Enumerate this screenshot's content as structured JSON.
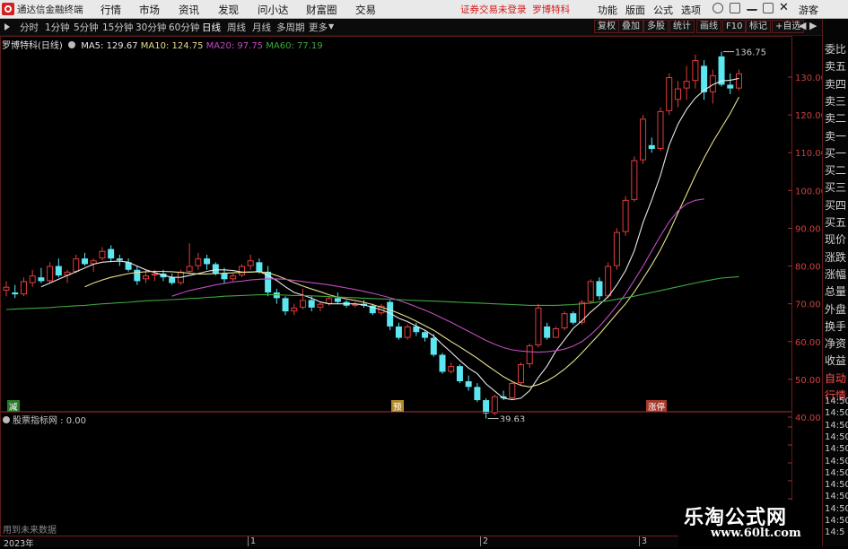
{
  "app": {
    "title": "通达信金融终端"
  },
  "menu": [
    "行情",
    "市场",
    "资讯",
    "发现",
    "问小达",
    "财富圈",
    "交易"
  ],
  "notice": "证券交易未登录",
  "stock_tag": "罗博特科",
  "toolbar_right": [
    "功能",
    "版面",
    "公式",
    "选项"
  ],
  "guest": "游客",
  "periods": [
    "分时",
    "1分钟",
    "5分钟",
    "15分钟",
    "30分钟",
    "60分钟",
    "日线",
    "周线",
    "月线",
    "多周期",
    "更多"
  ],
  "active_period": "日线",
  "right_buttons": [
    "复权",
    "叠加",
    "多股",
    "统计",
    "画线",
    "F10",
    "标记",
    "+自选"
  ],
  "chart_header": {
    "stock": "罗博特科",
    "period": "(日线)",
    "ma5": "MA5: 129.67",
    "ma10": "MA10: 124.75",
    "ma20": "MA20: 97.75",
    "ma60": "MA60: 77.19"
  },
  "price_axis": [
    "130.00",
    "120.00",
    "110.00",
    "100.00",
    "90.00",
    "80.00",
    "70.00",
    "60.00",
    "50.00",
    "40.00"
  ],
  "annotations": {
    "high": "136.75",
    "low": "39.63"
  },
  "event_markers": [
    "减",
    "预",
    "涨停"
  ],
  "right_panel": [
    "委比",
    "卖五",
    "卖四",
    "卖三",
    "卖二",
    "卖一",
    "买一",
    "买二",
    "买三",
    "买四",
    "买五",
    "现价",
    "涨跌",
    "涨幅",
    "总量",
    "外盘",
    "换手",
    "净资",
    "收益",
    "自动",
    "行情",
    "14:50",
    "14:50",
    "14:50",
    "14:50",
    "14:50",
    "14:50",
    "14:50",
    "14:50",
    "14:50",
    "14:50",
    "14:50",
    "14:5"
  ],
  "sub_indicator": "股票指标网 : 0.00",
  "nodata": "用到未来数据",
  "time_axis": [
    "2023年",
    "1",
    "2",
    "3"
  ],
  "watermark": {
    "title": "乐淘公式网",
    "url": "www.60lt.com"
  },
  "colors": {
    "up": "#e33b3b",
    "down": "#5ce6f0",
    "ma5": "#e8e8e8",
    "ma10": "#e8df8c",
    "ma20": "#c04bc0",
    "ma60": "#3fa73f"
  },
  "chart_data": {
    "type": "candlestick",
    "ylim": [
      37,
      142
    ],
    "candles": [
      {
        "o": 73.5,
        "h": 76,
        "l": 72,
        "c": 74.5
      },
      {
        "o": 73,
        "h": 75,
        "l": 71.5,
        "c": 72.5
      },
      {
        "o": 72.5,
        "h": 77,
        "l": 72,
        "c": 76
      },
      {
        "o": 75.5,
        "h": 79,
        "l": 74.5,
        "c": 77.5
      },
      {
        "o": 77,
        "h": 79.5,
        "l": 75.5,
        "c": 76
      },
      {
        "o": 76,
        "h": 81,
        "l": 75.5,
        "c": 80
      },
      {
        "o": 80,
        "h": 82,
        "l": 77,
        "c": 77.5
      },
      {
        "o": 77.5,
        "h": 79,
        "l": 75.5,
        "c": 78.5
      },
      {
        "o": 78.5,
        "h": 83,
        "l": 78,
        "c": 82
      },
      {
        "o": 82,
        "h": 83.5,
        "l": 80,
        "c": 80.5
      },
      {
        "o": 80.5,
        "h": 82,
        "l": 78.5,
        "c": 81.5
      },
      {
        "o": 82,
        "h": 85,
        "l": 81.5,
        "c": 84
      },
      {
        "o": 84.5,
        "h": 85.5,
        "l": 81,
        "c": 82
      },
      {
        "o": 82,
        "h": 83,
        "l": 80,
        "c": 81.5
      },
      {
        "o": 81,
        "h": 82,
        "l": 78.5,
        "c": 79
      },
      {
        "o": 79,
        "h": 80,
        "l": 75,
        "c": 76
      },
      {
        "o": 76.5,
        "h": 79,
        "l": 75.5,
        "c": 77.5
      },
      {
        "o": 77.5,
        "h": 79,
        "l": 76,
        "c": 78
      },
      {
        "o": 78,
        "h": 79,
        "l": 76,
        "c": 77
      },
      {
        "o": 77,
        "h": 78,
        "l": 75,
        "c": 75.5
      },
      {
        "o": 75.5,
        "h": 79,
        "l": 75,
        "c": 78.5
      },
      {
        "o": 78.5,
        "h": 86,
        "l": 78,
        "c": 80
      },
      {
        "o": 80,
        "h": 83.5,
        "l": 79,
        "c": 82
      },
      {
        "o": 82,
        "h": 83,
        "l": 79,
        "c": 80.5
      },
      {
        "o": 80.5,
        "h": 81,
        "l": 77.5,
        "c": 78
      },
      {
        "o": 78,
        "h": 79.5,
        "l": 75.5,
        "c": 76.5
      },
      {
        "o": 76.5,
        "h": 78,
        "l": 76,
        "c": 77.5
      },
      {
        "o": 77.5,
        "h": 80.5,
        "l": 77,
        "c": 80
      },
      {
        "o": 80,
        "h": 83,
        "l": 79,
        "c": 81.5
      },
      {
        "o": 81,
        "h": 82,
        "l": 78,
        "c": 78.5
      },
      {
        "o": 78.5,
        "h": 80,
        "l": 72,
        "c": 73
      },
      {
        "o": 73,
        "h": 74,
        "l": 70,
        "c": 71.5
      },
      {
        "o": 71.5,
        "h": 72,
        "l": 67,
        "c": 68
      },
      {
        "o": 68,
        "h": 70,
        "l": 67,
        "c": 69
      },
      {
        "o": 69,
        "h": 74,
        "l": 68.5,
        "c": 71
      },
      {
        "o": 71,
        "h": 72,
        "l": 68,
        "c": 69
      },
      {
        "o": 69,
        "h": 70.5,
        "l": 68,
        "c": 70
      },
      {
        "o": 70,
        "h": 72,
        "l": 69.5,
        "c": 71.5
      },
      {
        "o": 71.5,
        "h": 73,
        "l": 70,
        "c": 70.5
      },
      {
        "o": 70.5,
        "h": 71,
        "l": 69,
        "c": 69.5
      },
      {
        "o": 69.5,
        "h": 70.5,
        "l": 69,
        "c": 70
      },
      {
        "o": 70,
        "h": 71,
        "l": 69,
        "c": 69.5
      },
      {
        "o": 69.5,
        "h": 70,
        "l": 67,
        "c": 67.5
      },
      {
        "o": 67.5,
        "h": 70,
        "l": 67,
        "c": 69.5
      },
      {
        "o": 70.5,
        "h": 71,
        "l": 63,
        "c": 64
      },
      {
        "o": 64,
        "h": 65,
        "l": 60.5,
        "c": 61
      },
      {
        "o": 61,
        "h": 64.5,
        "l": 60.5,
        "c": 64
      },
      {
        "o": 64,
        "h": 65,
        "l": 61.5,
        "c": 62.5
      },
      {
        "o": 62.5,
        "h": 63,
        "l": 60,
        "c": 61
      },
      {
        "o": 61,
        "h": 62,
        "l": 56,
        "c": 56.5
      },
      {
        "o": 56.5,
        "h": 57,
        "l": 51.5,
        "c": 52
      },
      {
        "o": 52,
        "h": 54.5,
        "l": 51.5,
        "c": 53.5
      },
      {
        "o": 53.5,
        "h": 54,
        "l": 49,
        "c": 49.5
      },
      {
        "o": 49.5,
        "h": 51,
        "l": 47,
        "c": 48
      },
      {
        "o": 48,
        "h": 49,
        "l": 44,
        "c": 44.5
      },
      {
        "o": 44.5,
        "h": 45,
        "l": 39.63,
        "c": 41
      },
      {
        "o": 41,
        "h": 46,
        "l": 40.5,
        "c": 45.5
      },
      {
        "o": 45.5,
        "h": 47,
        "l": 44.5,
        "c": 45
      },
      {
        "o": 45,
        "h": 49.5,
        "l": 44.5,
        "c": 49
      },
      {
        "o": 49,
        "h": 54.5,
        "l": 48.5,
        "c": 54
      },
      {
        "o": 54,
        "h": 59.5,
        "l": 53,
        "c": 59
      },
      {
        "o": 59,
        "h": 70,
        "l": 58.5,
        "c": 69
      },
      {
        "o": 64,
        "h": 65,
        "l": 60.5,
        "c": 61
      },
      {
        "o": 61,
        "h": 64,
        "l": 61,
        "c": 63.5
      },
      {
        "o": 63.5,
        "h": 68,
        "l": 63,
        "c": 67.5
      },
      {
        "o": 67.5,
        "h": 68,
        "l": 64.5,
        "c": 65
      },
      {
        "o": 65,
        "h": 71,
        "l": 64.5,
        "c": 70.5
      },
      {
        "o": 70.5,
        "h": 76.5,
        "l": 70,
        "c": 76
      },
      {
        "o": 76,
        "h": 77,
        "l": 71,
        "c": 72
      },
      {
        "o": 72,
        "h": 81,
        "l": 71.5,
        "c": 80
      },
      {
        "o": 80,
        "h": 90,
        "l": 79,
        "c": 89
      },
      {
        "o": 89,
        "h": 98.5,
        "l": 88,
        "c": 97.5
      },
      {
        "o": 97.5,
        "h": 109,
        "l": 97,
        "c": 108
      },
      {
        "o": 108,
        "h": 120,
        "l": 107,
        "c": 119
      },
      {
        "o": 112,
        "h": 114,
        "l": 110,
        "c": 111
      },
      {
        "o": 111,
        "h": 122,
        "l": 110.5,
        "c": 121
      },
      {
        "o": 121,
        "h": 131,
        "l": 120,
        "c": 130
      },
      {
        "o": 124,
        "h": 129,
        "l": 122,
        "c": 127
      },
      {
        "o": 127,
        "h": 133,
        "l": 124,
        "c": 129
      },
      {
        "o": 129,
        "h": 136,
        "l": 127,
        "c": 134.5
      },
      {
        "o": 133,
        "h": 134.5,
        "l": 124,
        "c": 126
      },
      {
        "o": 126,
        "h": 132,
        "l": 123,
        "c": 130.5
      },
      {
        "o": 135.5,
        "h": 136.75,
        "l": 127.5,
        "c": 128
      },
      {
        "o": 128,
        "h": 131,
        "l": 125.5,
        "c": 127
      },
      {
        "o": 127,
        "h": 132,
        "l": 126.5,
        "c": 131
      }
    ],
    "ma": [
      {
        "name": "MA5",
        "values": [
          null,
          null,
          null,
          null,
          74.5,
          75.5,
          76.5,
          77.5,
          78.5,
          79.5,
          80.5,
          81,
          81.2,
          81.3,
          81,
          80,
          79,
          78.3,
          77.6,
          77,
          77,
          77.5,
          78,
          78.6,
          79,
          79,
          78.8,
          78.4,
          78.4,
          78.6,
          77.5,
          76.2,
          74.5,
          73,
          72.3,
          71.5,
          70.5,
          70,
          70,
          70,
          70,
          69.7,
          69.1,
          68.4,
          67.5,
          66.2,
          65.3,
          64.1,
          63,
          61.5,
          59.2,
          57.2,
          55,
          53,
          51.5,
          48.8,
          46.9,
          45,
          44.6,
          45,
          47,
          50.5,
          53.5,
          57.5,
          60.5,
          63.5,
          65.5,
          67.8,
          69.8,
          71.9,
          75,
          78.8,
          84,
          91.5,
          97.5,
          104,
          112,
          117.5,
          121.5,
          124.5,
          126.5,
          128,
          129,
          129.2,
          129.67
        ]
      },
      {
        "name": "MA10",
        "values": [
          null,
          null,
          null,
          null,
          null,
          null,
          null,
          null,
          null,
          74.5,
          75.5,
          76.3,
          77,
          77.5,
          78,
          78.3,
          78.5,
          78.6,
          78.6,
          78.5,
          78.3,
          78.1,
          77.9,
          77.9,
          78,
          78.1,
          78.2,
          78.3,
          78.4,
          78.5,
          78.2,
          77.5,
          76.6,
          75.6,
          74.7,
          73.9,
          73.2,
          72.4,
          71.8,
          71.3,
          70.9,
          70.4,
          69.8,
          69.1,
          68.4,
          67.5,
          66.5,
          65.4,
          64.2,
          63,
          61.5,
          60,
          58.6,
          57.1,
          55.6,
          53.9,
          52.3,
          50.7,
          49.4,
          48.4,
          48,
          48.6,
          49.6,
          51,
          52.7,
          54.7,
          57,
          59.5,
          62,
          64.7,
          67.4,
          70,
          73.1,
          76.7,
          80.3,
          84.3,
          88.9,
          94,
          99,
          104,
          108.6,
          112.8,
          116.6,
          120.4,
          124.75
        ]
      },
      {
        "name": "MA20",
        "values": [
          null,
          null,
          null,
          null,
          null,
          null,
          null,
          null,
          null,
          null,
          null,
          null,
          null,
          null,
          null,
          null,
          null,
          null,
          null,
          72,
          72.8,
          73.5,
          74,
          74.5,
          75,
          75.4,
          75.8,
          76,
          76.3,
          76.5,
          76.6,
          76.6,
          76.5,
          76.2,
          75.9,
          75.6,
          75.3,
          75,
          74.6,
          74.2,
          73.8,
          73.3,
          72.8,
          72.2,
          71.6,
          70.9,
          70.1,
          69.2,
          68.3,
          67.3,
          66.2,
          65.1,
          63.9,
          62.7,
          61.5,
          60.3,
          59.3,
          58.4,
          57.8,
          57.5,
          57.3,
          57.2,
          57.3,
          57.6,
          58,
          58.8,
          60,
          61.8,
          64,
          66.7,
          69.5,
          72.6,
          76.2,
          80,
          84,
          88,
          91.7,
          94.6,
          96.5,
          97.4,
          97.75
        ]
      },
      {
        "name": "MA60",
        "values": [
          68.5,
          68.6,
          68.7,
          68.8,
          68.9,
          69,
          69.2,
          69.3,
          69.5,
          69.6,
          69.8,
          70,
          70.1,
          70.3,
          70.4,
          70.6,
          70.8,
          70.9,
          71,
          71.1,
          71.2,
          71.4,
          71.5,
          71.7,
          71.8,
          72,
          72.1,
          72.2,
          72.3,
          72.4,
          72.4,
          72.4,
          72.3,
          72.2,
          72.2,
          72.1,
          72,
          71.9,
          71.8,
          71.7,
          71.6,
          71.5,
          71.4,
          71.3,
          71.2,
          71.1,
          71,
          70.9,
          70.8,
          70.7,
          70.6,
          70.5,
          70.4,
          70.3,
          70.2,
          70.1,
          70,
          69.9,
          69.8,
          69.7,
          69.6,
          69.6,
          69.6,
          69.6,
          69.7,
          69.8,
          70,
          70.2,
          70.5,
          70.8,
          71.2,
          71.6,
          72,
          72.5,
          73,
          73.5,
          74,
          74.5,
          75,
          75.5,
          76,
          76.4,
          76.8,
          77,
          77.19
        ]
      }
    ]
  }
}
